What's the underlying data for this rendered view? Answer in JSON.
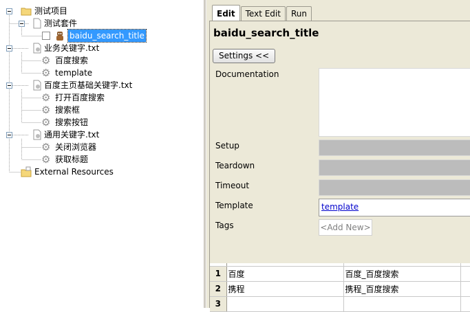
{
  "tree": {
    "project": "测试项目",
    "suite": "测试套件",
    "selected_test": "baidu_search_title",
    "resources": [
      {
        "name": "业务关键字.txt",
        "keywords": [
          "百度搜索",
          "template"
        ]
      },
      {
        "name": "百度主页基础关键字.txt",
        "keywords": [
          "打开百度搜索",
          "搜索框",
          "搜索按钮"
        ]
      },
      {
        "name": "通用关键字.txt",
        "keywords": [
          "关闭浏览器",
          "获取标题"
        ]
      }
    ],
    "external": "External Resources"
  },
  "tabs": [
    {
      "label": "Edit",
      "active": true
    },
    {
      "label": "Text Edit",
      "active": false
    },
    {
      "label": "Run",
      "active": false
    }
  ],
  "editor": {
    "title": "baidu_search_title",
    "settings_button": "Settings <<",
    "fields": {
      "documentation": "Documentation",
      "setup": "Setup",
      "teardown": "Teardown",
      "timeout": "Timeout",
      "template": "Template",
      "tags": "Tags"
    },
    "template_value": "template",
    "tags_placeholder": "<Add New>",
    "grid": {
      "rows": [
        {
          "num": "1",
          "cells": [
            "百度",
            "百度_百度搜索",
            ""
          ]
        },
        {
          "num": "2",
          "cells": [
            "携程",
            "携程_百度搜索",
            ""
          ]
        },
        {
          "num": "3",
          "cells": [
            "",
            "",
            ""
          ]
        }
      ]
    }
  }
}
